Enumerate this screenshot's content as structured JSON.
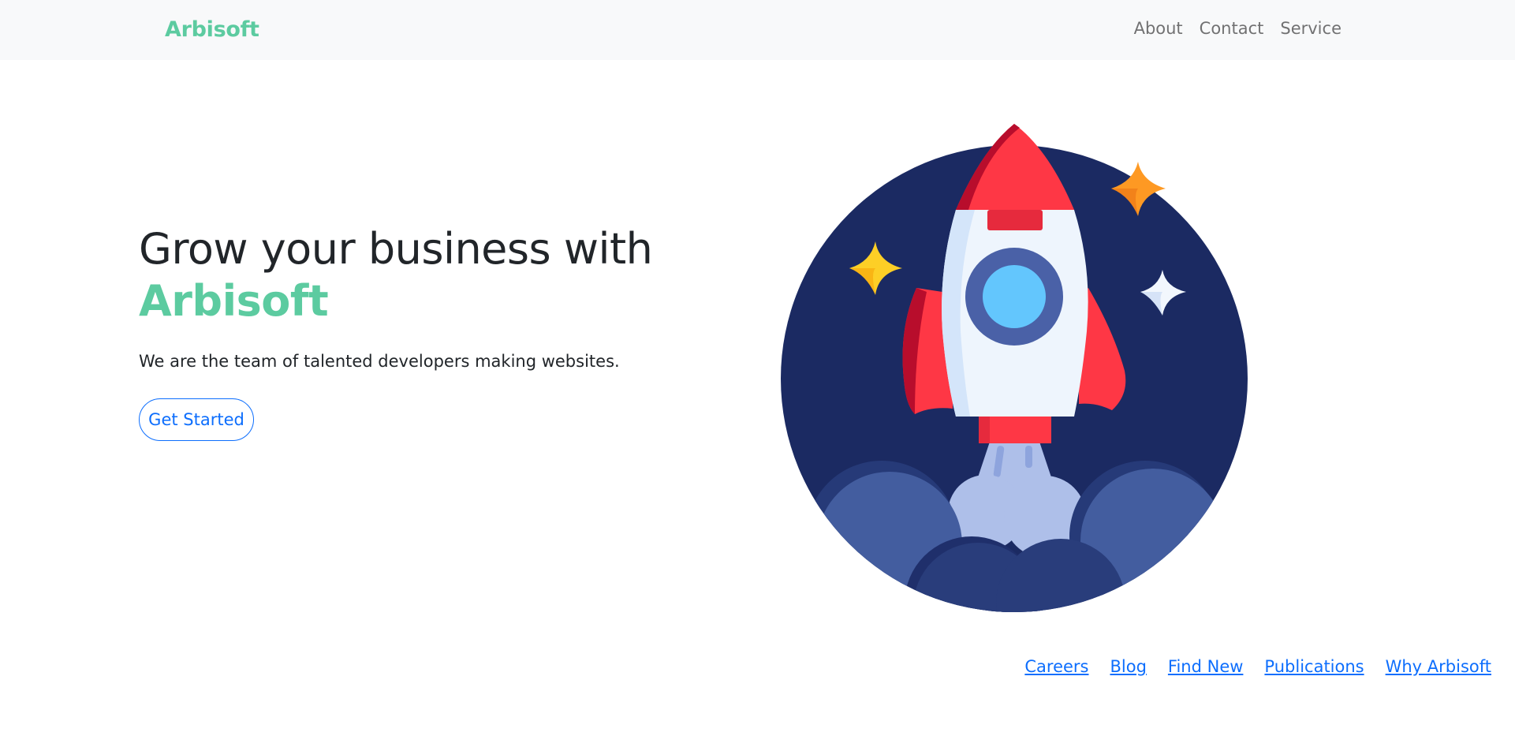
{
  "navbar": {
    "brand": "Arbisoft",
    "links": [
      {
        "label": "About"
      },
      {
        "label": "Contact"
      },
      {
        "label": "Service"
      }
    ]
  },
  "hero": {
    "title": "Grow your business with",
    "title_accent": "Arbisoft",
    "subtitle": "We are the team of talented developers making websites.",
    "cta_label": "Get Started",
    "illustration": "rocket-launch-illustration"
  },
  "footer": {
    "links": [
      {
        "label": "Careers"
      },
      {
        "label": "Blog"
      },
      {
        "label": "Find New"
      },
      {
        "label": "Publications"
      },
      {
        "label": "Why Arbisoft"
      }
    ]
  },
  "colors": {
    "brand": "#5ccba0",
    "primary": "#0d6efd",
    "navbar_bg": "#f8f9fa",
    "text": "#212529",
    "illustration_bg": "#1b2a62",
    "rocket_red": "#fe3745"
  }
}
